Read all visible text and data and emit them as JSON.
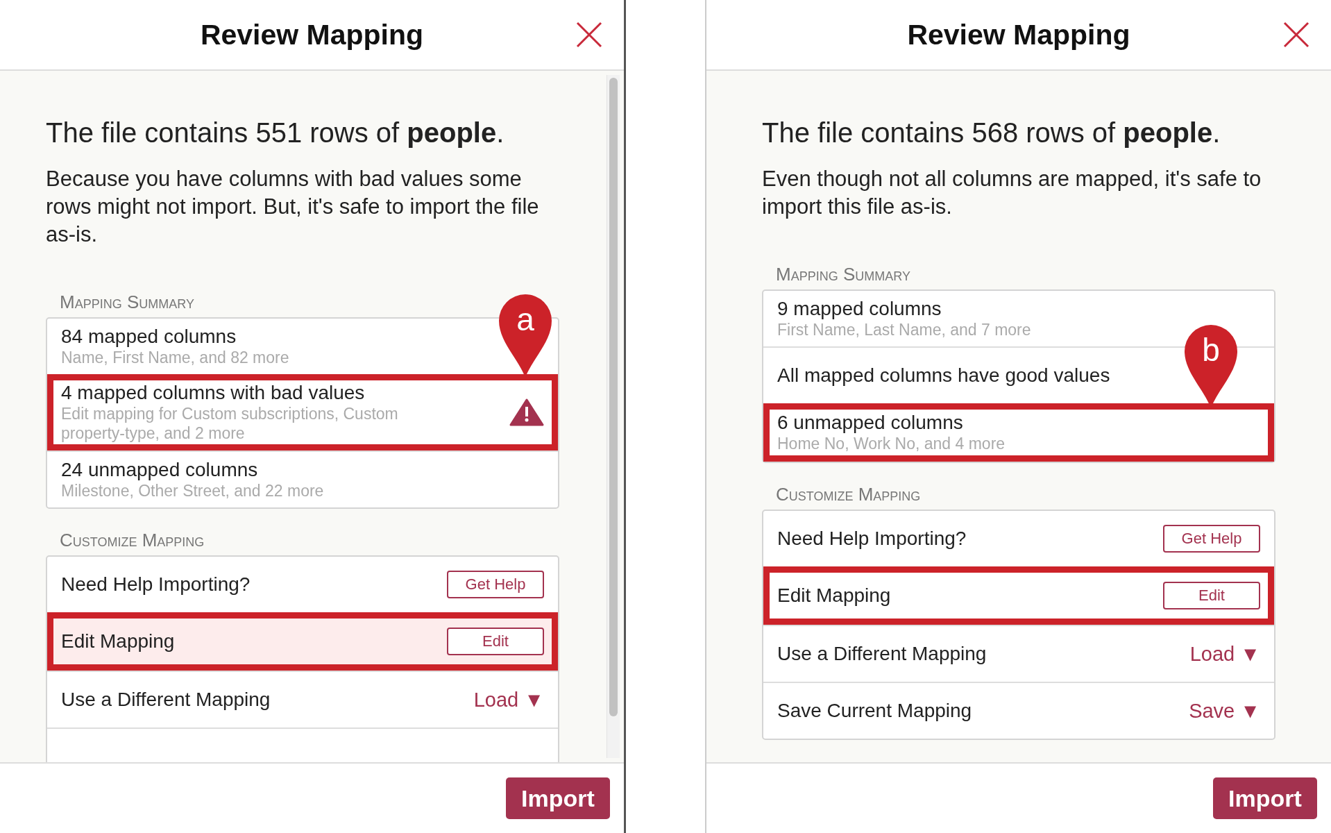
{
  "panels": [
    {
      "title": "Review Mapping",
      "headline": "The file contains 551 rows of **people**.",
      "message": "Because you have columns with bad values some rows might not import. But, it's safe to import the file as-is.",
      "scrollbar": true,
      "sections": [
        {
          "heading": "Mapping Summary",
          "rows": [
            {
              "kind": "summary",
              "title": "84 mapped columns",
              "detail": "Name, First Name, and 82 more",
              "warning": false,
              "highlighted": false,
              "tinted": false
            },
            {
              "kind": "summary",
              "title": "4 mapped columns with bad values",
              "detail": "Edit mapping for Custom subscriptions, Custom property-type, and 2 more",
              "warning": true,
              "highlighted": true,
              "tinted": false,
              "callout": "a"
            },
            {
              "kind": "summary",
              "title": "24 unmapped columns",
              "detail": "Milestone, Other Street, and 22 more",
              "warning": false,
              "highlighted": false,
              "tinted": false
            }
          ]
        },
        {
          "heading": "Customize Mapping",
          "rows": [
            {
              "kind": "button",
              "title": "Need Help Importing?",
              "action": "Get Help",
              "highlighted": false,
              "tinted": false
            },
            {
              "kind": "button",
              "title": "Edit Mapping",
              "action": "Edit",
              "highlighted": true,
              "tinted": true
            },
            {
              "kind": "menu",
              "title": "Use a Different Mapping",
              "action": "Load",
              "caret": "▼",
              "highlighted": false,
              "tinted": false
            }
          ]
        }
      ],
      "primary_button": "Import"
    },
    {
      "title": "Review Mapping",
      "headline": "The file contains 568 rows of **people**.",
      "message": "Even though not all columns are mapped, it's safe to import this file as-is.",
      "scrollbar": false,
      "sections": [
        {
          "heading": "Mapping Summary",
          "rows": [
            {
              "kind": "summary",
              "title": "9 mapped columns",
              "detail": "First Name, Last Name, and 7 more",
              "warning": false,
              "highlighted": false,
              "tinted": false
            },
            {
              "kind": "summary",
              "title": "All mapped columns have good values",
              "warning": false,
              "highlighted": false,
              "tinted": false
            },
            {
              "kind": "summary",
              "title": "6 unmapped columns",
              "detail": "Home No, Work No, and 4 more",
              "warning": false,
              "highlighted": true,
              "tinted": false,
              "callout": "b"
            }
          ]
        },
        {
          "heading": "Customize Mapping",
          "rows": [
            {
              "kind": "button",
              "title": "Need Help Importing?",
              "action": "Get Help",
              "highlighted": false,
              "tinted": false
            },
            {
              "kind": "button",
              "title": "Edit Mapping",
              "action": "Edit",
              "highlighted": true,
              "tinted": false
            },
            {
              "kind": "menu",
              "title": "Use a Different Mapping",
              "action": "Load",
              "caret": "▼",
              "highlighted": false,
              "tinted": false
            },
            {
              "kind": "menu",
              "title": "Save Current Mapping",
              "action": "Save",
              "caret": "▼",
              "highlighted": false,
              "tinted": false
            }
          ]
        }
      ],
      "primary_button": "Import"
    }
  ]
}
